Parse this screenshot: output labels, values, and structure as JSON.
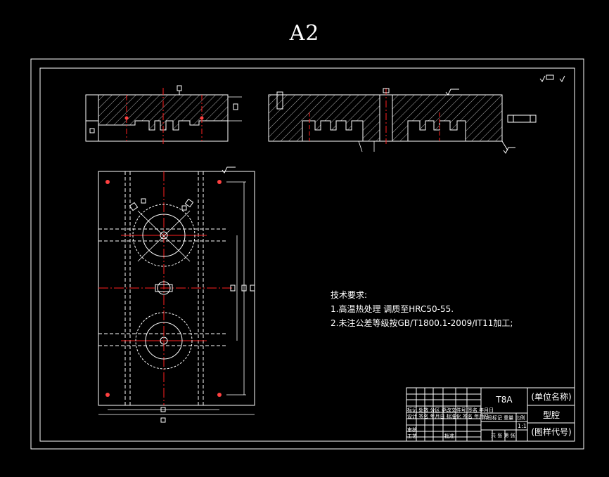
{
  "sheet": {
    "size_label": "A2"
  },
  "roughness_symbol": "√▭·√",
  "technical_requirements": {
    "heading": "技术要求:",
    "items": [
      "1.高温热处理 调质至HRC50-55.",
      "2.未注公差等级按GB/T1800.1-2009/IT11加工;"
    ]
  },
  "title_block": {
    "material": "T8A",
    "company": "(单位名称)",
    "part_name": "型腔",
    "drawing_number": "(图样代号)",
    "row1": "标记 处数 分区 更改文件号 签名 年月日",
    "row2": "设计 签名 年月日 标准化 签名 年月日",
    "stage_label": "阶段标记 重量 比例",
    "scale": "1:1",
    "reviewer": "审核",
    "process": "工艺",
    "approve": "批准",
    "sheets": "共  张 第  张"
  },
  "colors": {
    "background": "#000000",
    "lines": "#ffffff",
    "centerline": "#ff2020",
    "hole": "#ff4040"
  }
}
